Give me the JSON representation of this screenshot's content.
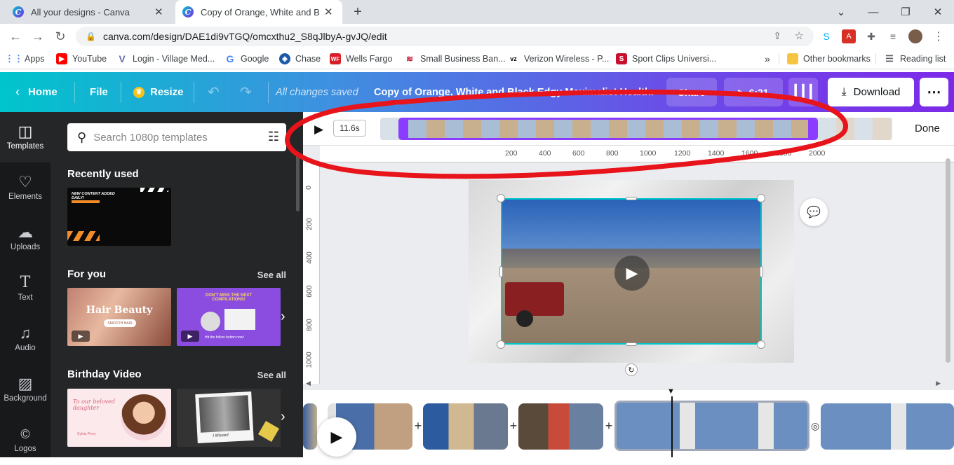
{
  "browser": {
    "tabs": [
      {
        "title": "All your designs - Canva"
      },
      {
        "title": "Copy of Orange, White and Black"
      }
    ],
    "new_tab": "+",
    "url": "canva.com/design/DAE1di9vTGQ/omcxthu2_S8qJlbyA-gvJQ/edit",
    "bookmarks": [
      {
        "label": "Apps",
        "icon": "apps-grid-icon",
        "color": "#4285f4"
      },
      {
        "label": "YouTube",
        "icon": "youtube-icon",
        "color": "#ff0000"
      },
      {
        "label": "Login - Village Med...",
        "icon": "village-med-icon",
        "color": "#6a6fb5"
      },
      {
        "label": "Google",
        "icon": "google-icon",
        "color": "#4285f4"
      },
      {
        "label": "Chase",
        "icon": "chase-icon",
        "color": "#1a5aa8"
      },
      {
        "label": "Wells Fargo",
        "icon": "wells-fargo-icon",
        "color": "#d71e28"
      },
      {
        "label": "Small Business Ban...",
        "icon": "bank-icon",
        "color": "#c41230"
      },
      {
        "label": "Verizon Wireless - P...",
        "icon": "verizon-icon",
        "color": "#000000"
      },
      {
        "label": "Sport Clips Universi...",
        "icon": "sportclips-icon",
        "color": "#c8102e"
      }
    ],
    "bookmarks_more": "»",
    "other_bookmarks": "Other bookmarks",
    "reading_list": "Reading list"
  },
  "header": {
    "home": "Home",
    "file": "File",
    "resize": "Resize",
    "saved_status": "All changes saved",
    "doc_title": "Copy of Orange, White and Black Edgy Maximalist Health...",
    "share": "Share",
    "duration": "6:21",
    "download": "Download",
    "accent": "#7d2ae8"
  },
  "rail": [
    {
      "label": "Templates",
      "icon": "templates-icon"
    },
    {
      "label": "Elements",
      "icon": "elements-icon"
    },
    {
      "label": "Uploads",
      "icon": "uploads-icon"
    },
    {
      "label": "Text",
      "icon": "text-icon"
    },
    {
      "label": "Audio",
      "icon": "audio-icon"
    },
    {
      "label": "Background",
      "icon": "background-icon"
    },
    {
      "label": "Logos",
      "icon": "logos-icon"
    }
  ],
  "panel": {
    "search_placeholder": "Search 1080p templates",
    "recently_used": "Recently used",
    "recent_card_text": "NEW CONTENT ADDED DAILY!",
    "for_you": "For you",
    "birthday": "Birthday Video",
    "see_all": "See all",
    "hair_title": "Hair Beauty",
    "hair_sub": "SMOOTH HAIR",
    "compilation_text": "DON'T MISS THE NEXT COMPILATIONS!",
    "follow_text": "Hit the follow button now!",
    "birthday_card1": "To our beloved daughter",
    "birthday_card1_name": "Sylvia Perry",
    "birthday_card2": "I Missed"
  },
  "trim": {
    "time": "11.6s",
    "done": "Done"
  },
  "ruler": {
    "h": [
      "200",
      "400",
      "600",
      "800",
      "1000",
      "1200",
      "1400",
      "1600",
      "1800",
      "2000"
    ],
    "v": [
      "0",
      "200",
      "400",
      "600",
      "800",
      "1000"
    ]
  },
  "timeline": {
    "playhead_marker": "▼"
  }
}
